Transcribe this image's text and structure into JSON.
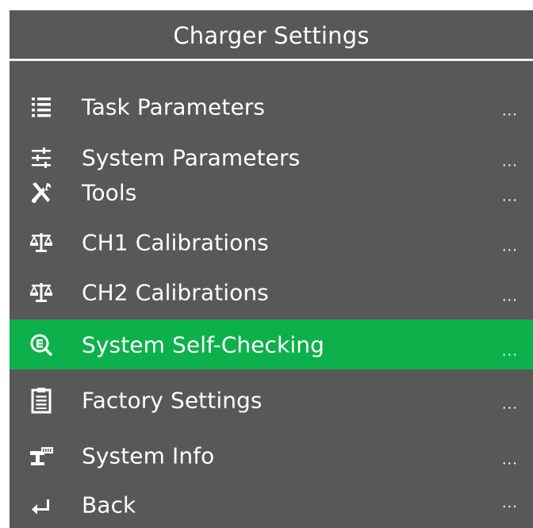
{
  "header": {
    "title": "Charger Settings"
  },
  "colors": {
    "background": "#585858",
    "selected": "#0db14b",
    "text": "#ffffff",
    "divider": "#f2f2f2"
  },
  "menu": {
    "selected_index": 5,
    "items": [
      {
        "label": "Task Parameters",
        "icon": "list-icon",
        "more": "..."
      },
      {
        "label": "System Parameters",
        "icon": "sliders-icon",
        "more": "..."
      },
      {
        "label": "Tools",
        "icon": "tools-icon",
        "more": "..."
      },
      {
        "label": "CH1 Calibrations",
        "icon": "scale-icon",
        "more": "..."
      },
      {
        "label": "CH2 Calibrations",
        "icon": "scale-icon",
        "more": "..."
      },
      {
        "label": "System Self-Checking",
        "icon": "self-check-icon",
        "more": "..."
      },
      {
        "label": "Factory Settings",
        "icon": "clipboard-icon",
        "more": "..."
      },
      {
        "label": "System Info",
        "icon": "network-icon",
        "more": "..."
      },
      {
        "label": "Back",
        "icon": "return-arrow-icon",
        "more": "..."
      }
    ]
  }
}
